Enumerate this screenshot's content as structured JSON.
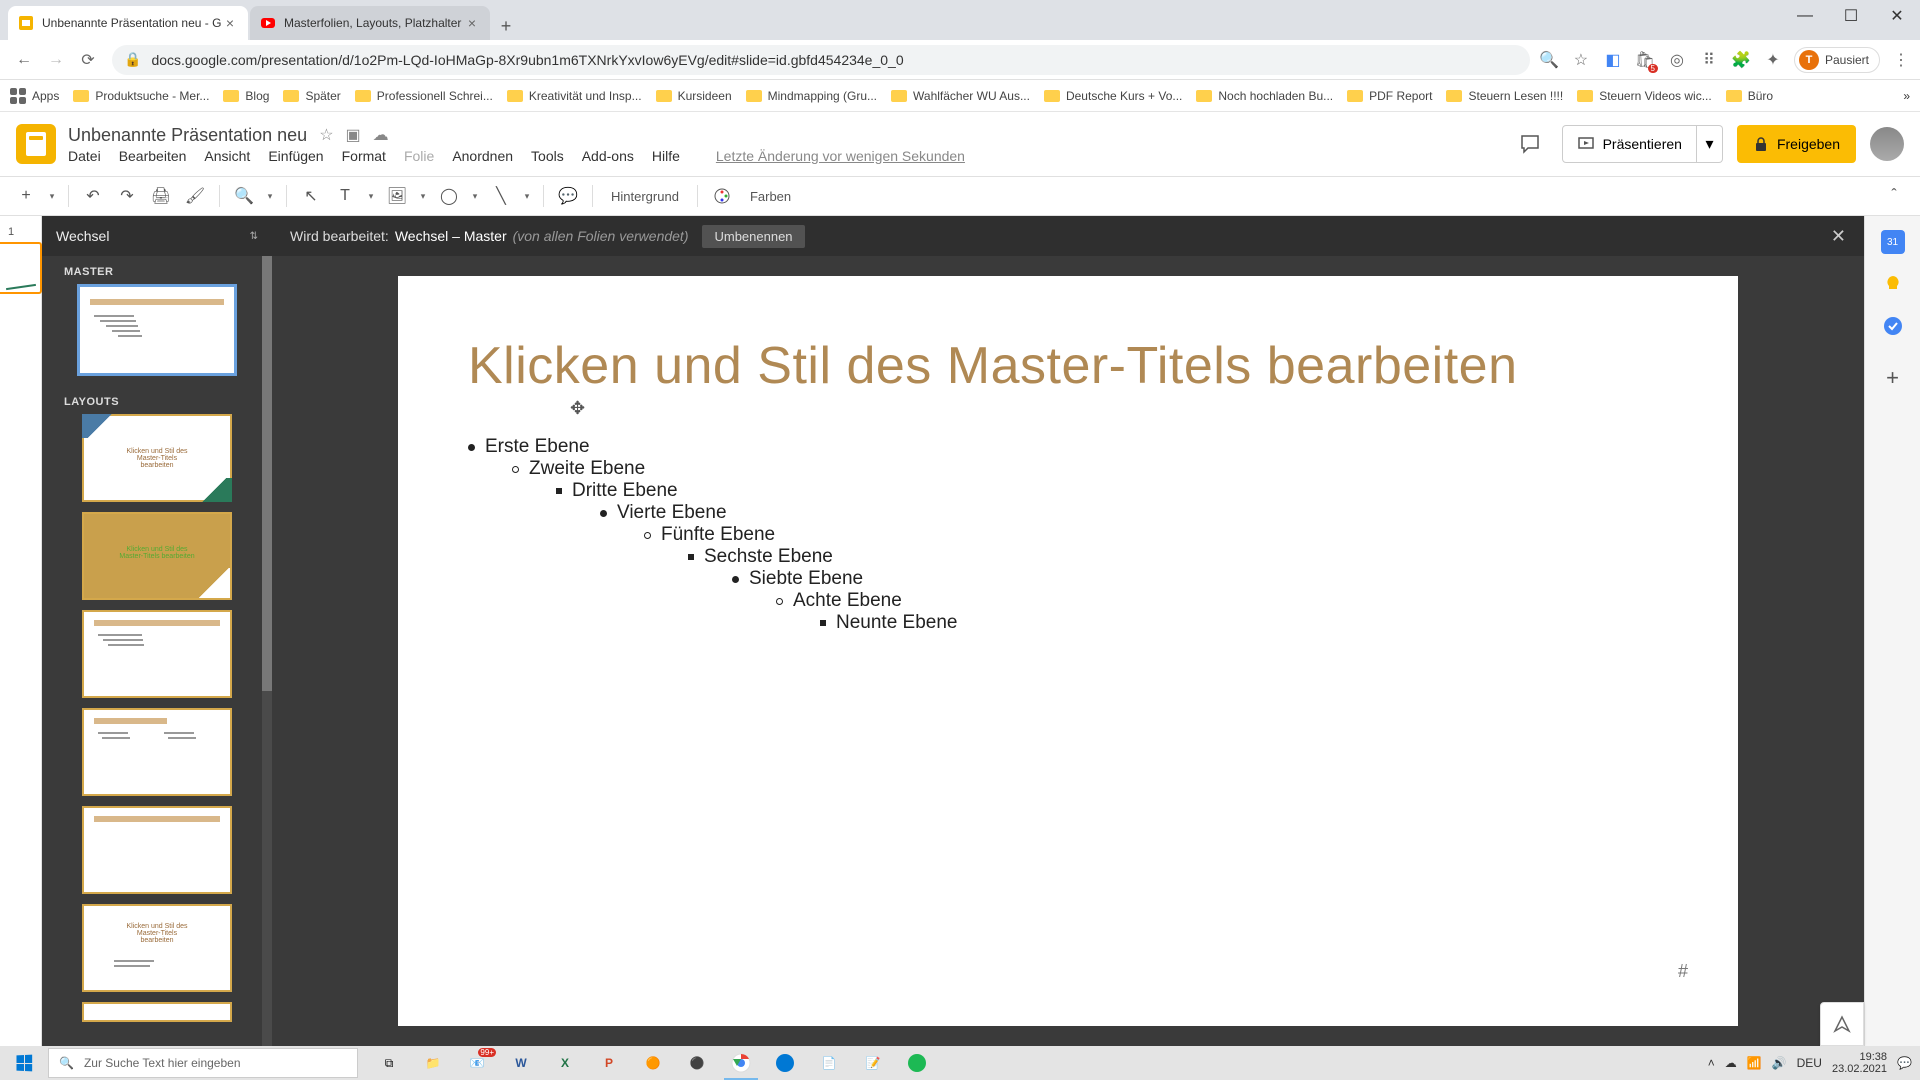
{
  "browser": {
    "tabs": [
      {
        "title": "Unbenannte Präsentation neu - G",
        "active": true
      },
      {
        "title": "Masterfolien, Layouts, Platzhalter",
        "active": false
      }
    ],
    "url": "docs.google.com/presentation/d/1o2Pm-LQd-IoHMaGp-8Xr9ubn1m6TXNrkYxvIow6yEVg/edit#slide=id.gbfd454234e_0_0",
    "paused": "Pausiert",
    "avatar_letter": "T"
  },
  "bookmarks": {
    "apps": "Apps",
    "items": [
      "Produktsuche - Mer...",
      "Blog",
      "Später",
      "Professionell Schrei...",
      "Kreativität und Insp...",
      "Kursideen",
      "Mindmapping  (Gru...",
      "Wahlfächer WU Aus...",
      "Deutsche Kurs + Vo...",
      "Noch hochladen Bu...",
      "PDF Report",
      "Steuern Lesen !!!!",
      "Steuern Videos wic...",
      "Büro"
    ]
  },
  "doc": {
    "title": "Unbenannte Präsentation neu",
    "menus": [
      "Datei",
      "Bearbeiten",
      "Ansicht",
      "Einfügen",
      "Format",
      "Folie",
      "Anordnen",
      "Tools",
      "Add-ons",
      "Hilfe"
    ],
    "disabled_menu": "Folie",
    "last_edit": "Letzte Änderung vor wenigen Sekunden",
    "present": "Präsentieren",
    "share": "Freigeben"
  },
  "toolbar": {
    "background": "Hintergrund",
    "colors": "Farben"
  },
  "master": {
    "theme": "Wechsel",
    "master_label": "MASTER",
    "layouts_label": "LAYOUTS",
    "editing_prefix": "Wird bearbeitet:",
    "editing_name": "Wechsel – Master",
    "editing_usage": "(von allen Folien verwendet)",
    "rename": "Umbenennen"
  },
  "slide": {
    "title": "Klicken und Stil des Master-Titels bearbeiten",
    "levels": [
      "Erste Ebene",
      "Zweite Ebene",
      "Dritte Ebene",
      "Vierte Ebene",
      "Fünfte Ebene",
      "Sechste Ebene",
      "Siebte Ebene",
      "Achte Ebene",
      "Neunte Ebene"
    ],
    "number_placeholder": "#"
  },
  "filmstrip": {
    "slide_number": "1"
  },
  "taskbar": {
    "search_placeholder": "Zur Suche Text hier eingeben",
    "lang": "DEU",
    "time": "19:38",
    "date": "23.02.2021",
    "mail_badge": "99+"
  },
  "colors": {
    "accent_gold": "#c9a04c",
    "title_brown": "#b08954",
    "share_yellow": "#fbbc04"
  }
}
